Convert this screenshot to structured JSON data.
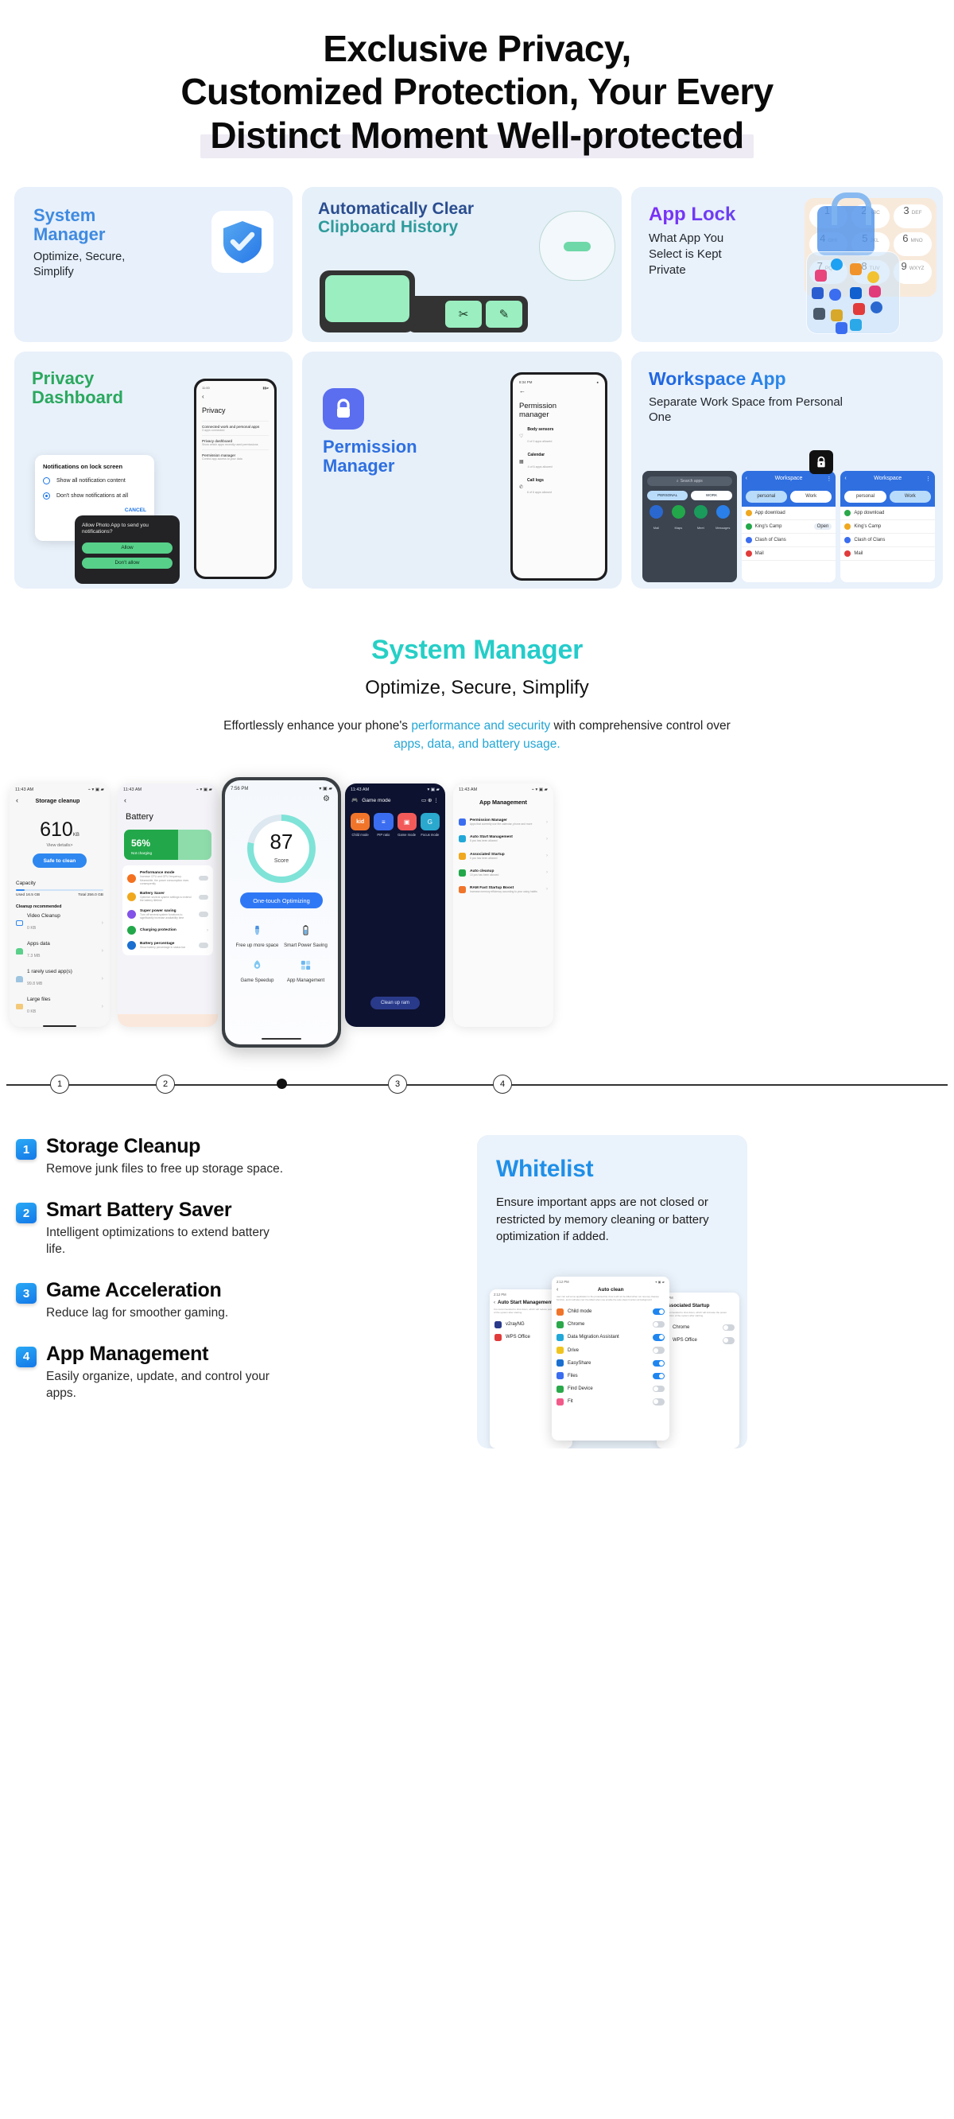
{
  "hero": {
    "line1": "Exclusive Privacy,",
    "line2": "Customized Protection, Your Every",
    "line3": "Distinct Moment Well-protected"
  },
  "feature_cards": {
    "system_manager": {
      "title_line1": "System",
      "title_line2": "Manager",
      "subtitle": "Optimize, Secure, Simplify",
      "icon": "shield-check-icon"
    },
    "clipboard": {
      "title_line1": "Automatically Clear",
      "title_line2": "Clipboard History",
      "key1": "✂",
      "key2": "✎"
    },
    "app_lock": {
      "title": "App Lock",
      "subtitle": "What App You Select is Kept Private",
      "keypad": [
        {
          "digit": "1",
          "letters": ""
        },
        {
          "digit": "2",
          "letters": "ABC"
        },
        {
          "digit": "3",
          "letters": "DEF"
        },
        {
          "digit": "4",
          "letters": "GHI"
        },
        {
          "digit": "5",
          "letters": "JKL"
        },
        {
          "digit": "6",
          "letters": "MNO"
        },
        {
          "digit": "7",
          "letters": "PQRS"
        },
        {
          "digit": "8",
          "letters": "TUV"
        },
        {
          "digit": "9",
          "letters": "WXYZ"
        }
      ]
    },
    "privacy_dashboard": {
      "title_line1": "Privacy",
      "title_line2": "Dashboard",
      "phone_status_time": "11:00",
      "phone_title": "Privacy",
      "phone_items": [
        {
          "label": "Connected work and personal apps",
          "sub": "3 apps connected"
        },
        {
          "label": "Privacy dashboard",
          "sub": "Show which apps recently used permissions"
        },
        {
          "label": "Permission manager",
          "sub": "Control app access to your data"
        }
      ],
      "notif_title": "Notifications on lock screen",
      "notif_opt1": "Show all notification content",
      "notif_opt2": "Don't show notifications at all",
      "notif_cancel": "CANCEL",
      "dark_prompt": "Allow Photo App to send you notifications?",
      "dark_allow": "Allow",
      "dark_deny": "Don't allow"
    },
    "permission_manager": {
      "title_line1": "Permission",
      "title_line2": "Manager",
      "icon": "lock-icon",
      "phone_time": "8:34 PM",
      "phone_title_line1": "Permission",
      "phone_title_line2": "manager",
      "phone_items": [
        {
          "label": "Body sensors",
          "sub": "0 of 0 apps allowed",
          "icon": "heart-icon"
        },
        {
          "label": "Calendar",
          "sub": "4 of 6 apps allowed",
          "icon": "calendar-icon"
        },
        {
          "label": "Call logs",
          "sub": "6 of 6 apps allowed",
          "icon": "phone-icon"
        }
      ]
    },
    "workspace": {
      "title": "Workspace App",
      "subtitle": "Separate Work Space from Personal One",
      "search_placeholder": "Search apps",
      "tab_personal_caps": "PERSONAL",
      "tab_work_caps": "WORK",
      "home_apps": [
        "Mail",
        "Maps",
        "Meet",
        "Messages"
      ],
      "screen_title": "Workspace",
      "tab_personal": "personal",
      "tab_work": "Work",
      "rows": [
        {
          "label": "App download",
          "action": ""
        },
        {
          "label": "King's Camp",
          "action": "Open"
        },
        {
          "label": "Clash of Clans",
          "action": ""
        },
        {
          "label": "Mail",
          "action": ""
        }
      ]
    }
  },
  "system_manager_section": {
    "heading": "System Manager",
    "subheading": "Optimize, Secure, Simplify",
    "desc_part1": "Effortlessly enhance your phone's ",
    "desc_accent1": "performance and security",
    "desc_part2": " with comprehensive control over ",
    "desc_accent2": "apps, data, and battery usage."
  },
  "carousel": {
    "phone_storage": {
      "status_time": "11:43 AM",
      "title": "Storage cleanup",
      "value": "610",
      "unit": "KB",
      "view_details": "View details>",
      "cta": "Safe to clean",
      "capacity_label": "Capacity",
      "used": "Used 16.5 GB",
      "total": "Total 256.0 GB",
      "section": "Cleanup recommended",
      "items": [
        {
          "label": "Video Cleanup",
          "size": "0 KB"
        },
        {
          "label": "Apps data",
          "size": "7.3 MB"
        },
        {
          "label": "1 rarely used app(s)",
          "size": "99.8 MB"
        },
        {
          "label": "Large files",
          "size": "0 KB"
        }
      ]
    },
    "phone_battery": {
      "status_time": "11:43 AM",
      "title": "Battery",
      "percent": "56%",
      "charging_status": "Not charging",
      "items": [
        {
          "label": "Performance mode",
          "sub": "Increase CPU and GPU frequency. Meanwhile, the power consumption rises consequently",
          "color": "#f4711f"
        },
        {
          "label": "Battery Saver",
          "sub": "Optimize several system settings to extend the battery lifetime",
          "color": "#f0a81e"
        },
        {
          "label": "Super power saving",
          "sub": "Turn off several system functions to significantly increase availability time",
          "color": "#8352e8"
        },
        {
          "label": "Charging protection",
          "sub": "",
          "color": "#22a84a"
        },
        {
          "label": "Battery percentage",
          "sub": "Show battery percentage in status bar",
          "color": "#1a6fd0"
        }
      ]
    },
    "phone_main": {
      "status_time": "7:56 PM",
      "score": "87",
      "score_label": "Score",
      "cta": "One-touch Optimizing",
      "actions": [
        {
          "label": "Free up more space",
          "icon": "broom-icon"
        },
        {
          "label": "Smart Power Saving",
          "icon": "battery-icon"
        },
        {
          "label": "Game Speedup",
          "icon": "rocket-icon"
        },
        {
          "label": "App Management",
          "icon": "apps-icon"
        }
      ]
    },
    "phone_game": {
      "status_time": "11:43 AM",
      "title": "Game mode",
      "tiles": [
        {
          "label": "Child mode",
          "color": "#f0752a",
          "glyph": "kid"
        },
        {
          "label": "PIP ratio",
          "color": "#3b6df0",
          "glyph": "≡"
        },
        {
          "label": "Game mode",
          "color": "#f25a5a",
          "glyph": "▣"
        },
        {
          "label": "Focus mode",
          "color": "#2aa8ce",
          "glyph": "G"
        }
      ],
      "cta": "Clean up ram"
    },
    "phone_appmgmt": {
      "status_time": "11:43 AM",
      "title": "App Management",
      "items": [
        {
          "label": "Permission Manager",
          "sub": "Apps that currently use the calendar, phone and more",
          "color": "#3b6df0"
        },
        {
          "label": "Auto Start Management",
          "sub": "8 pcs has been allowed",
          "color": "#22a8d8"
        },
        {
          "label": "Associated Startup",
          "sub": "0 pcs has been allowed",
          "color": "#f0a81e"
        },
        {
          "label": "Auto cleanup",
          "sub": "10 pcs has been allowed",
          "color": "#22a84a"
        },
        {
          "label": "RAM Fast Startup Boost",
          "sub": "Increase memory efficiency according to your using habits",
          "color": "#f0752a"
        }
      ]
    },
    "dots": [
      "1",
      "2",
      "",
      "3",
      "4"
    ]
  },
  "features": [
    {
      "num": "1",
      "title": "Storage Cleanup",
      "desc": "Remove junk files to free up storage space."
    },
    {
      "num": "2",
      "title": "Smart Battery Saver",
      "desc": "Intelligent optimizations to extend battery life."
    },
    {
      "num": "3",
      "title": "Game Acceleration",
      "desc": "Reduce lag for smoother gaming."
    },
    {
      "num": "4",
      "title": "App Management",
      "desc": "Easily organize, update, and control your apps."
    }
  ],
  "whitelist": {
    "title": "Whitelist",
    "desc": "Ensure important apps are not closed or restricted by memory cleaning or battery optimization if added.",
    "left_shot": {
      "time": "2:12 PM",
      "title": "Auto Start Management",
      "note": "It is recommended to shut down, which will reduce power consumption of the system after starting",
      "items": [
        {
          "label": "v2rayNG",
          "on": false
        },
        {
          "label": "WPS Office",
          "on": false
        }
      ]
    },
    "mid_shot": {
      "time": "2:12 PM",
      "title": "Auto clean",
      "note": "user can sell some application to the protected list, thus it will not be killed when run one key cleanup function, and it will also can't be killed when use enable the auto-clean function at background",
      "items": [
        {
          "label": "Child mode",
          "on": true,
          "color": "#f0752a"
        },
        {
          "label": "Chrome",
          "on": false,
          "color": "#2aa84a"
        },
        {
          "label": "Data Migration Assistant",
          "on": true,
          "color": "#22a8d8"
        },
        {
          "label": "Drive",
          "on": false,
          "color": "#f0c41e"
        },
        {
          "label": "EasyShare",
          "on": true,
          "color": "#1a6fd0"
        },
        {
          "label": "Files",
          "on": true,
          "color": "#3b6df0"
        },
        {
          "label": "Find Device",
          "on": false,
          "color": "#22a84a"
        },
        {
          "label": "Fit",
          "on": false,
          "color": "#f25a8a"
        }
      ]
    },
    "right_shot": {
      "time": "2:12 PM",
      "title": "Associated Startup",
      "note": "It is recommended to shut down, which will increase the power consumption of the system after starting",
      "items": [
        {
          "label": "Chrome",
          "on": false
        },
        {
          "label": "WPS Office",
          "on": false
        }
      ]
    }
  },
  "colors": {
    "accent_blue": "#1f8fe8",
    "accent_teal": "#28d8b8",
    "accent_green": "#2aa85e",
    "accent_purple": "#7b2ff7"
  }
}
